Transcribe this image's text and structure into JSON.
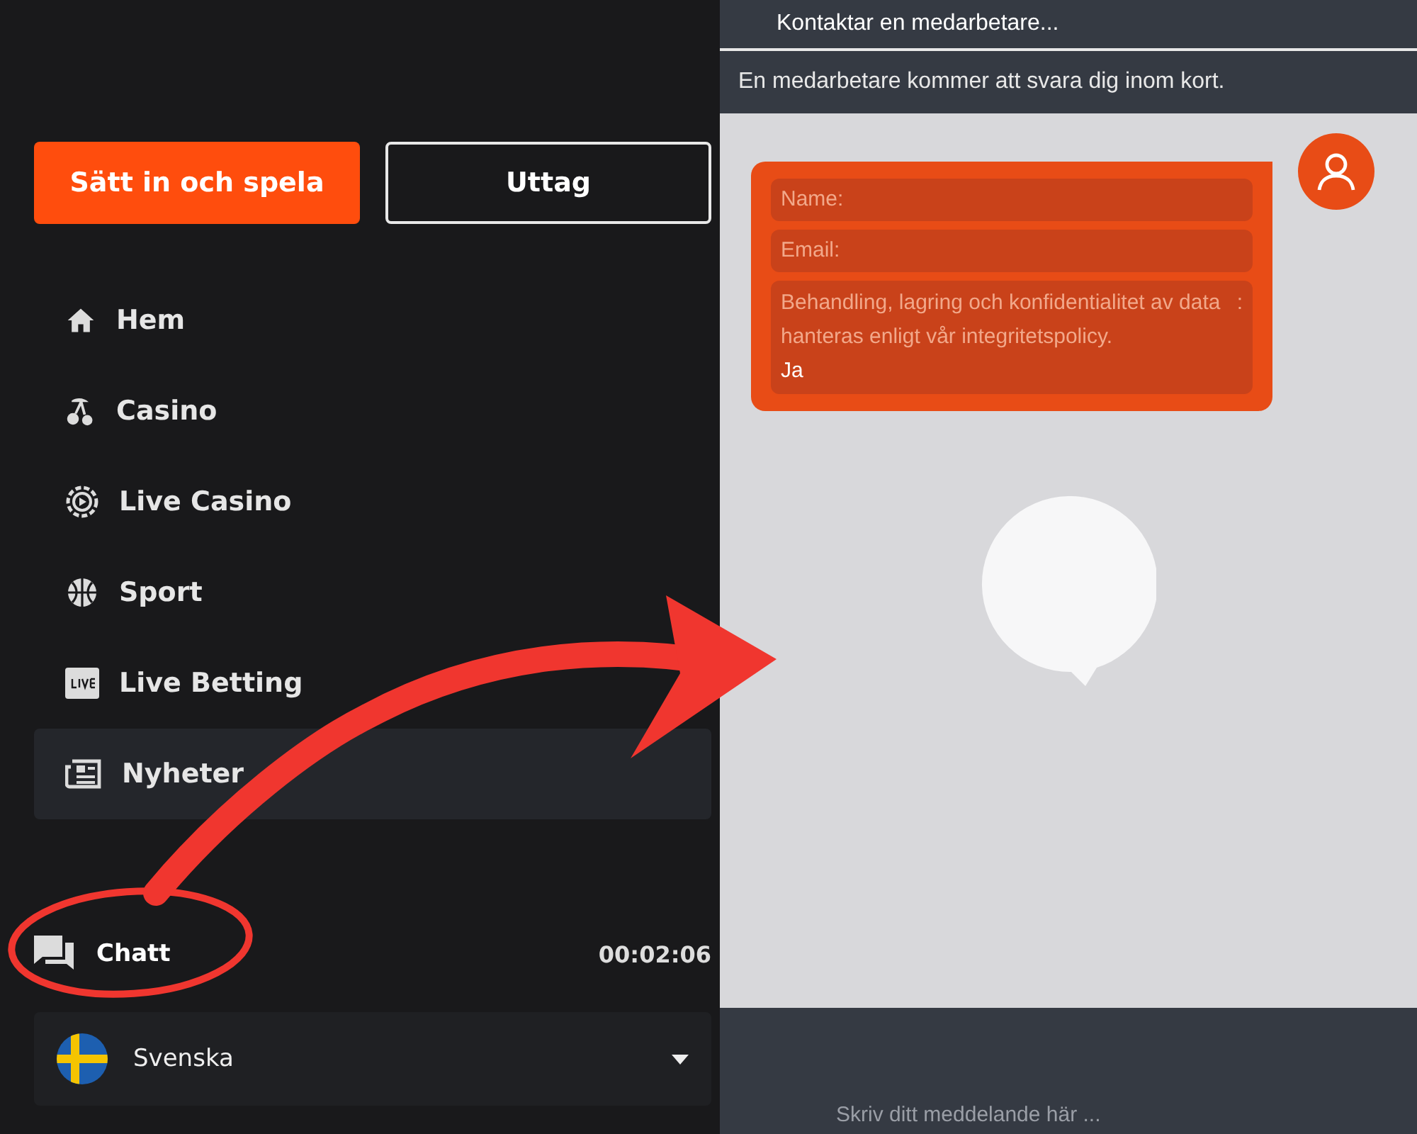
{
  "sidebar": {
    "buttons": [
      {
        "label": "Sätt in och spela",
        "kind": "primary"
      },
      {
        "label": "Uttag",
        "kind": "outline"
      }
    ],
    "items": [
      {
        "label": "Hem",
        "selected": false
      },
      {
        "label": "Casino",
        "selected": false
      },
      {
        "label": "Live Casino",
        "selected": false
      },
      {
        "label": "Sport",
        "selected": false
      },
      {
        "label": "Live Betting",
        "selected": false
      },
      {
        "label": "Nyheter",
        "selected": true
      }
    ],
    "chat": {
      "label": "Chatt",
      "timer": "00:02:06"
    },
    "language": {
      "label": "Svenska"
    }
  },
  "chat_window": {
    "title": "Kontaktar en medarbetare...",
    "notice": "En medarbetare kommer att svara dig inom kort.",
    "form": {
      "fields": [
        {
          "label": "Name:"
        },
        {
          "label": "Email:"
        }
      ],
      "consent": {
        "text": "Behandling, lagring och konfidentialitet av data hanteras enligt vår integritetspolicy.",
        "mark": ":",
        "answer": "Ja"
      }
    },
    "input": {
      "placeholder": "Skriv ditt meddelande här ..."
    }
  }
}
